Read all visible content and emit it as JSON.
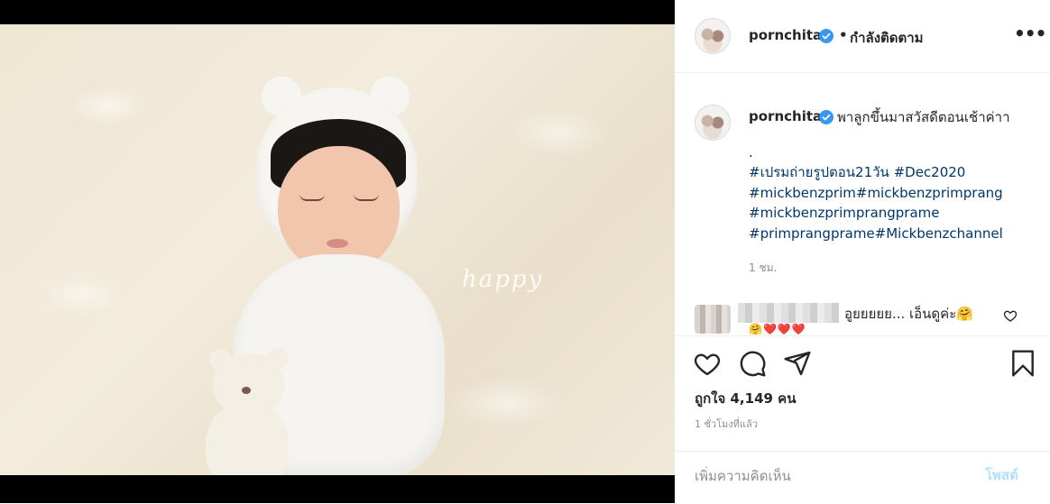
{
  "post": {
    "image_watermark": "happy",
    "image_subject": "newborn baby in white bear bonnet with teddy bear"
  },
  "header": {
    "username": "pornchita",
    "separator": "•",
    "follow_label": "กำลังติดตาม",
    "more_label": "•••"
  },
  "caption": {
    "username": "pornchita",
    "text": "พาลูกขึ้นมาสวัสดีตอนเช้าค่าา",
    "dot_line": ".",
    "hashtags": [
      "#เปรมถ่ายรูปตอน21วัน #Dec2020",
      "#mickbenzprim#mickbenzprimprang",
      "#mickbenzprimprangprame",
      "#primprangprame#Mickbenzchannel"
    ],
    "time": "1 ชม."
  },
  "comment": {
    "text": "อูยยยยย... เอ็นดูค่ะ🤗",
    "emoji_line": "🤗❤️❤️❤️"
  },
  "actions": {
    "like_icon": "heart-icon",
    "comment_icon": "comment-icon",
    "share_icon": "paper-plane-icon",
    "save_icon": "bookmark-icon"
  },
  "likes": {
    "label": "ถูกใจ 4,149 คน"
  },
  "post_time": "1 ชั่วโมงที่แล้ว",
  "add_comment": {
    "placeholder": "เพิ่มความคิดเห็น",
    "post_label": "โพสต์"
  },
  "colors": {
    "verified_blue": "#3897f0",
    "hashtag_blue": "#00376b",
    "post_btn_disabled": "#b2dffc",
    "muted_text": "#8e8e8e"
  }
}
